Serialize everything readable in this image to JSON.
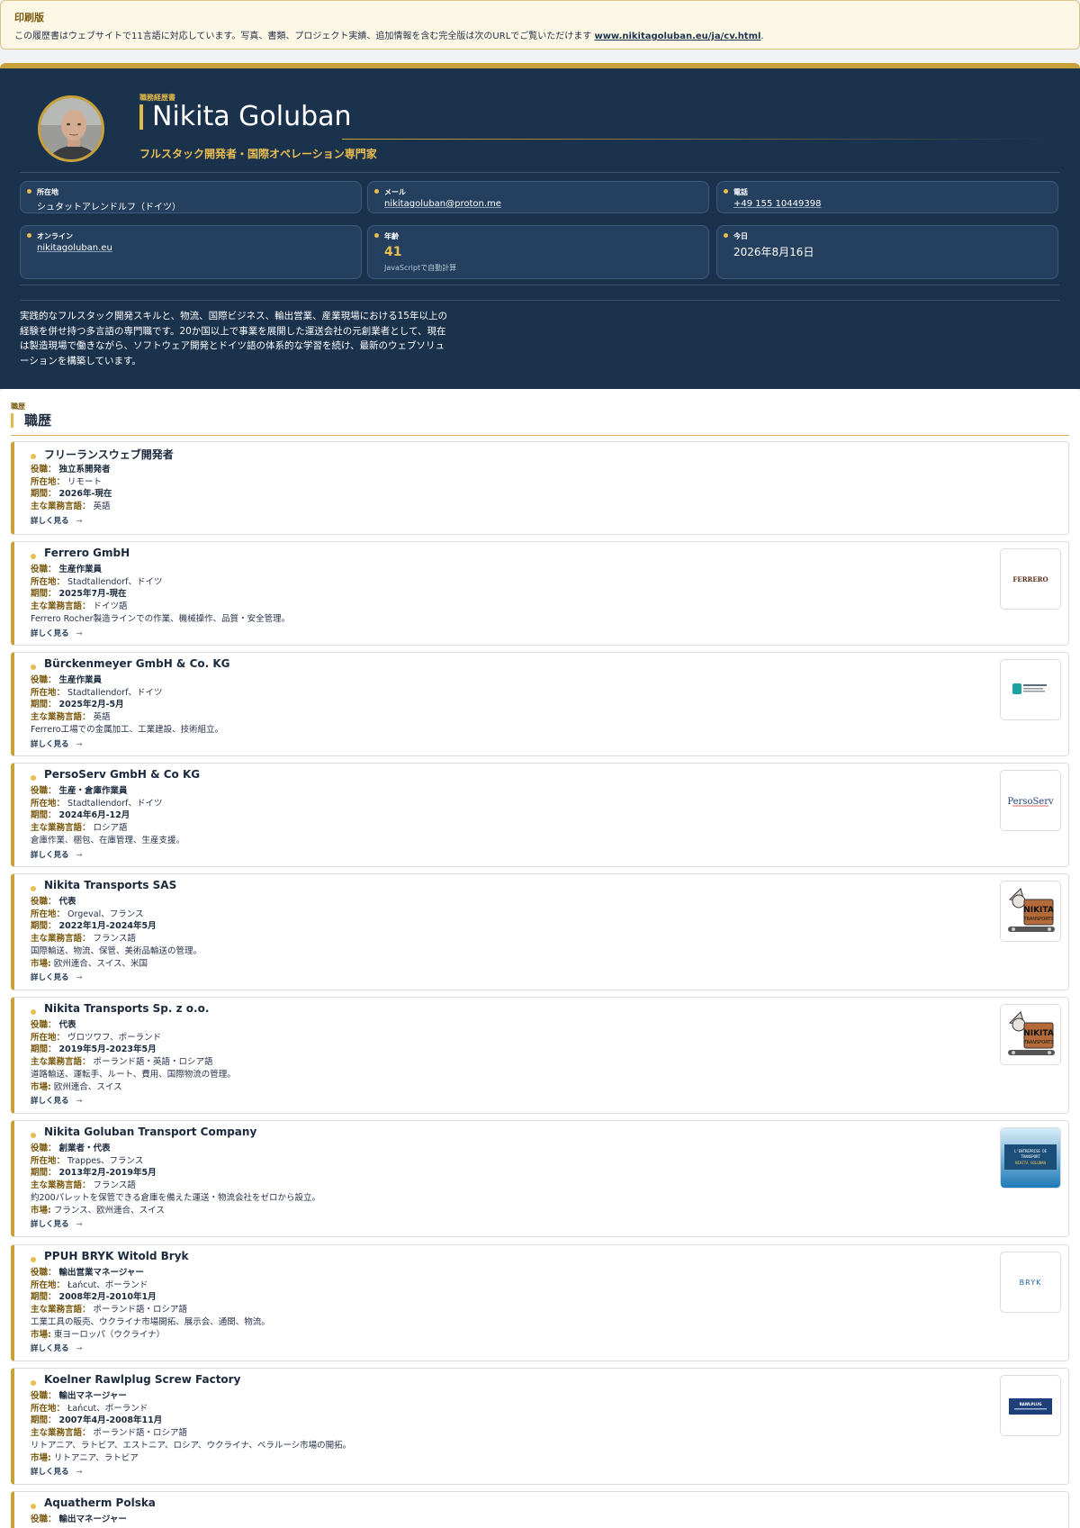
{
  "print_banner": {
    "title": "印刷版",
    "text": "この履歴書はウェブサイトで11言語に対応しています。写真、書類、プロジェクト実績、追加情報を含む完全版は次のURLでご覧いただけます ",
    "link": "www.nikitagoluban.eu/ja/cv.html",
    "end": "."
  },
  "header": {
    "doc_label": "職務経歴書",
    "name": "Nikita Goluban",
    "tagline": "フルスタック開発者・国際オペレーション専門家",
    "cards": {
      "location": {
        "label": "所在地",
        "value": "シュタットアレンドルフ（ドイツ）"
      },
      "email": {
        "label": "メール",
        "value": "nikitagoluban@proton.me"
      },
      "phone": {
        "label": "電話",
        "value": "+49 155 10449398"
      },
      "online": {
        "label": "オンライン",
        "value": "nikitagoluban.eu"
      },
      "age": {
        "label": "年齢",
        "value": "41",
        "note": "JavaScriptで自動計算"
      },
      "today": {
        "label": "今日",
        "value": "2026年8月16日"
      }
    },
    "summary": "実践的なフルスタック開発スキルと、物流、国際ビジネス、輸出営業、産業現場における15年以上の経験を併せ持つ多言語の専門職です。20か国以上で事業を展開した運送会社の元創業者として、現在は製造現場で働きながら、ソフトウェア開発とドイツ語の体系的な学習を続け、最新のウェブソリューションを構築しています。"
  },
  "experience": {
    "small_label": "職歴",
    "title": "職歴",
    "keys": {
      "role": "役職：",
      "location": "所在地：",
      "period": "期間：",
      "language": "主な業務言語：",
      "market": "市場:"
    },
    "more_label": "詳しく見る",
    "more_arrow": "→",
    "jobs": [
      {
        "company": "フリーランスウェブ開発者",
        "role": "独立系開発者",
        "location": "リモート",
        "period": "2026年-現在",
        "language": "英語"
      },
      {
        "company": "Ferrero GmbH",
        "role": "生産作業員",
        "location": "Stadtallendorf、ドイツ",
        "period": "2025年7月-現在",
        "language": "ドイツ語",
        "desc": "Ferrero Rocher製造ラインでの作業、機械操作、品質・安全管理。",
        "logo": "FERRERO"
      },
      {
        "company": "Bürckenmeyer GmbH & Co. KG",
        "role": "生産作業員",
        "location": "Stadtallendorf、ドイツ",
        "period": "2025年2月-5月",
        "language": "英語",
        "desc": "Ferrero工場での金属加工、工業建設、技術組立。",
        "logo": "BÜRCKENMEYER"
      },
      {
        "company": "PersoServ GmbH & Co KG",
        "role": "生産・倉庫作業員",
        "location": "Stadtallendorf、ドイツ",
        "period": "2024年6月-12月",
        "language": "ロシア語",
        "desc": "倉庫作業、梱包、在庫管理、生産支援。",
        "logo": "PersoServ"
      },
      {
        "company": "Nikita Transports SAS",
        "role": "代表",
        "location": "Orgeval、フランス",
        "period": "2022年1月-2024年5月",
        "language": "フランス語",
        "desc": "国際輸送、物流、保管、美術品輸送の管理。",
        "market": "欧州連合、スイス、米国",
        "logo": "NIKITA TRANSPORTS"
      },
      {
        "company": "Nikita Transports Sp. z o.o.",
        "role": "代表",
        "location": "ヴロツワフ、ポーランド",
        "period": "2019年5月-2023年5月",
        "language": "ポーランド語・英語・ロシア語",
        "desc": "道路輸送、運転手、ルート、費用、国際物流の管理。",
        "market": "欧州連合、スイス",
        "logo": "NIKITA TRANSPORTS"
      },
      {
        "company": "Nikita Goluban Transport Company",
        "role": "創業者・代表",
        "location": "Trappes、フランス",
        "period": "2013年2月-2019年5月",
        "language": "フランス語",
        "desc": "約200パレットを保管できる倉庫を備えた運送・物流会社をゼロから設立。",
        "market": "フランス、欧州連合、スイス",
        "logo": "L'ENTREPRISE DE TRANSPORT NIKITA GOLUBAN"
      },
      {
        "company": "PPUH BRYK Witold Bryk",
        "role": "輸出営業マネージャー",
        "location": "Łańcut、ポーランド",
        "period": "2008年2月-2010年1月",
        "language": "ポーランド語・ロシア語",
        "desc": "工業工具の販売、ウクライナ市場開拓、展示会、通関、物流。",
        "market": "東ヨーロッパ（ウクライナ）",
        "logo": "BRYK"
      },
      {
        "company": "Koelner Rawlplug Screw Factory",
        "role": "輸出マネージャー",
        "location": "Łańcut、ポーランド",
        "period": "2007年4月-2008年11月",
        "language": "ポーランド語・ロシア語",
        "desc": "リトアニア、ラトビア、エストニア、ロシア、ウクライナ、ベラルーシ市場の開拓。",
        "market": "リトアニア、ラトビア",
        "logo": "RAWLPLUG"
      },
      {
        "company": "Aquatherm Polska",
        "role": "輸出マネージャー"
      }
    ]
  },
  "colors": {
    "navy": "#1b324d",
    "gold": "#c9a13a",
    "gold_text": "#e8be52"
  }
}
